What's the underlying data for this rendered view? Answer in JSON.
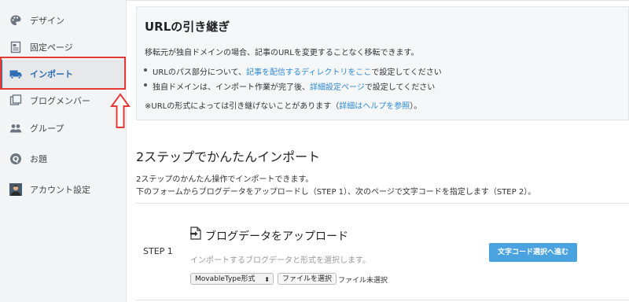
{
  "sidebar": {
    "items": [
      {
        "label": "デザイン",
        "icon": "palette-icon"
      },
      {
        "label": "固定ページ",
        "icon": "page-icon"
      },
      {
        "label": "インポート",
        "icon": "truck-icon",
        "active": true
      },
      {
        "label": "ブログメンバー",
        "icon": "members-icon"
      },
      {
        "label": "グループ",
        "icon": "group-icon"
      },
      {
        "label": "お題",
        "icon": "question-icon"
      },
      {
        "label": "アカウント設定",
        "icon": "avatar"
      }
    ]
  },
  "info": {
    "title": "URLの引き継ぎ",
    "desc": "移転元が独自ドメインの場合、記事のURLを変更することなく移転できます。",
    "bullet1_pre": "URLのパス部分について、",
    "bullet1_link": "記事を配信するディレクトリをここ",
    "bullet1_post": "で設定してください",
    "bullet2_pre": "独自ドメインは、インポート作業が完了後、",
    "bullet2_link": "詳細設定ページ",
    "bullet2_post": "で設定してください",
    "note_pre": "※URLの形式によっては引き継げないことがあります（",
    "note_link": "詳細はヘルプを参照",
    "note_post": "）。"
  },
  "section": {
    "title": "2ステップでかんたんインポート",
    "p1": "2ステップのかんたん操作でインポートできます。",
    "p2": "下のフォームからブログデータをアップロードし（STEP 1）、次のページで文字コードを指定します（STEP 2）。"
  },
  "step": {
    "label": "STEP 1",
    "title": "ブログデータをアップロード",
    "desc": "インポートするブログデータと形式を選択します。",
    "format_selected": "MovableType形式",
    "file_button": "ファイルを選択",
    "file_status": "ファイル未選択",
    "next_button": "文字コード選択へ進む"
  },
  "colors": {
    "accent": "#2f8ad6",
    "button": "#4aa3df",
    "highlight": "#e53935"
  }
}
